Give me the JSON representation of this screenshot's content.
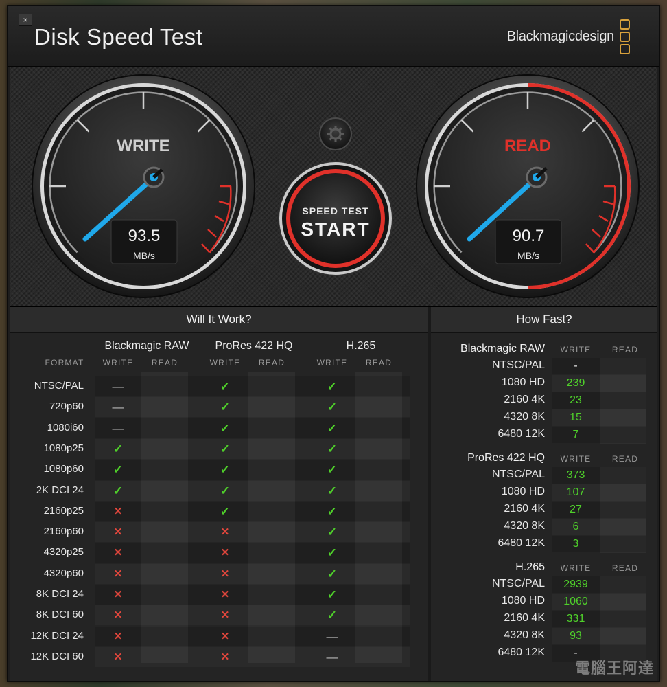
{
  "app": {
    "title": "Disk Speed Test",
    "brand": "Blackmagicdesign",
    "close_symbol": "×"
  },
  "write_gauge": {
    "label": "WRITE",
    "value": "93.5",
    "unit": "MB/s"
  },
  "read_gauge": {
    "label": "READ",
    "value": "90.7",
    "unit": "MB/s"
  },
  "start_button": {
    "line1": "SPEED TEST",
    "line2": "START"
  },
  "settings": {
    "icon": "gear-icon"
  },
  "colors": {
    "needle": "#1fa8ea",
    "read_accent": "#e0312a",
    "check": "#4fd02a",
    "cross": "#e0463c"
  },
  "will_it_work": {
    "title": "Will It Work?",
    "format_header": "FORMAT",
    "groups": [
      "Blackmagic RAW",
      "ProRes 422 HQ",
      "H.265"
    ],
    "sub_headers": [
      "WRITE",
      "READ"
    ],
    "rows": [
      {
        "format": "NTSC/PAL",
        "values": [
          "dash",
          "",
          "check",
          "",
          "check",
          ""
        ]
      },
      {
        "format": "720p60",
        "values": [
          "dash",
          "",
          "check",
          "",
          "check",
          ""
        ]
      },
      {
        "format": "1080i60",
        "values": [
          "dash",
          "",
          "check",
          "",
          "check",
          ""
        ]
      },
      {
        "format": "1080p25",
        "values": [
          "check",
          "",
          "check",
          "",
          "check",
          ""
        ]
      },
      {
        "format": "1080p60",
        "values": [
          "check",
          "",
          "check",
          "",
          "check",
          ""
        ]
      },
      {
        "format": "2K DCI 24",
        "values": [
          "check",
          "",
          "check",
          "",
          "check",
          ""
        ]
      },
      {
        "format": "2160p25",
        "values": [
          "cross",
          "",
          "check",
          "",
          "check",
          ""
        ]
      },
      {
        "format": "2160p60",
        "values": [
          "cross",
          "",
          "cross",
          "",
          "check",
          ""
        ]
      },
      {
        "format": "4320p25",
        "values": [
          "cross",
          "",
          "cross",
          "",
          "check",
          ""
        ]
      },
      {
        "format": "4320p60",
        "values": [
          "cross",
          "",
          "cross",
          "",
          "check",
          ""
        ]
      },
      {
        "format": "8K DCI 24",
        "values": [
          "cross",
          "",
          "cross",
          "",
          "check",
          ""
        ]
      },
      {
        "format": "8K DCI 60",
        "values": [
          "cross",
          "",
          "cross",
          "",
          "check",
          ""
        ]
      },
      {
        "format": "12K DCI 24",
        "values": [
          "cross",
          "",
          "cross",
          "",
          "dash",
          ""
        ]
      },
      {
        "format": "12K DCI 60",
        "values": [
          "cross",
          "",
          "cross",
          "",
          "dash",
          ""
        ]
      }
    ]
  },
  "how_fast": {
    "title": "How Fast?",
    "sub_headers": [
      "WRITE",
      "READ"
    ],
    "groups": [
      {
        "name": "Blackmagic RAW",
        "rows": [
          {
            "label": "NTSC/PAL",
            "write": "-",
            "read": ""
          },
          {
            "label": "1080 HD",
            "write": "239",
            "read": ""
          },
          {
            "label": "2160 4K",
            "write": "23",
            "read": ""
          },
          {
            "label": "4320 8K",
            "write": "15",
            "read": ""
          },
          {
            "label": "6480 12K",
            "write": "7",
            "read": ""
          }
        ]
      },
      {
        "name": "ProRes 422 HQ",
        "rows": [
          {
            "label": "NTSC/PAL",
            "write": "373",
            "read": ""
          },
          {
            "label": "1080 HD",
            "write": "107",
            "read": ""
          },
          {
            "label": "2160 4K",
            "write": "27",
            "read": ""
          },
          {
            "label": "4320 8K",
            "write": "6",
            "read": ""
          },
          {
            "label": "6480 12K",
            "write": "3",
            "read": ""
          }
        ]
      },
      {
        "name": "H.265",
        "rows": [
          {
            "label": "NTSC/PAL",
            "write": "2939",
            "read": ""
          },
          {
            "label": "1080 HD",
            "write": "1060",
            "read": ""
          },
          {
            "label": "2160 4K",
            "write": "331",
            "read": ""
          },
          {
            "label": "4320 8K",
            "write": "93",
            "read": ""
          },
          {
            "label": "6480 12K",
            "write": "-",
            "read": ""
          }
        ]
      }
    ]
  },
  "watermark": "電腦王阿達"
}
